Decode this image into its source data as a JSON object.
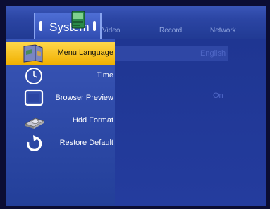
{
  "tabs": {
    "active": "System",
    "others": [
      "Video",
      "Record",
      "Network"
    ]
  },
  "menu": {
    "items": [
      {
        "label": "Menu Language",
        "icon": "map-book-icon",
        "selected": true
      },
      {
        "label": "Time",
        "icon": "clock-icon",
        "selected": false
      },
      {
        "label": "Browser Preview",
        "icon": "tv-monitor-icon",
        "selected": false
      },
      {
        "label": "Hdd Format",
        "icon": "hard-disk-icon",
        "selected": false
      },
      {
        "label": "Restore Default",
        "icon": "restore-arrow-icon",
        "selected": false
      }
    ]
  },
  "values": {
    "menu_language": "English",
    "browser_preview": "On"
  },
  "colors": {
    "selected_bg": "#f5c21a",
    "panel_bg": "#2b45a3",
    "value_text": "#4f67c6"
  }
}
